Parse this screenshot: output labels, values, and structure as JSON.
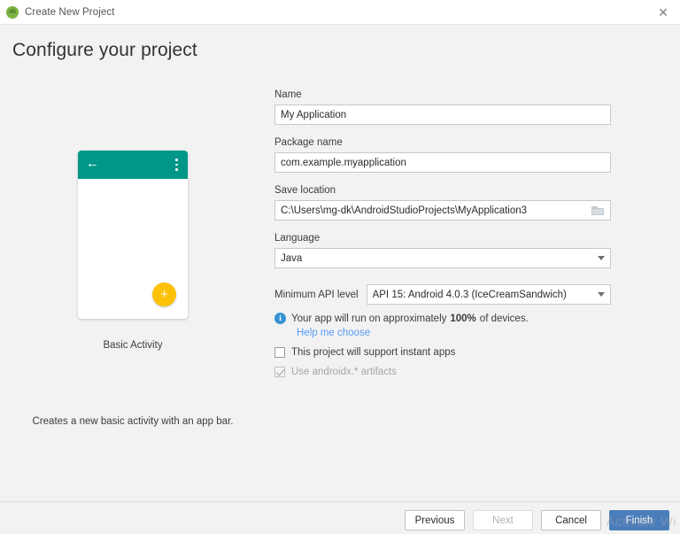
{
  "titlebar": {
    "title": "Create New Project",
    "icon": "android-icon",
    "close_label": "✕"
  },
  "heading": "Configure your project",
  "preview": {
    "activity_name": "Basic Activity",
    "description": "Creates a new basic activity with an app bar.",
    "appbar_color": "#009688",
    "fab_color": "#ffc107",
    "back_icon": "←",
    "fab_icon": "+"
  },
  "form": {
    "name": {
      "label": "Name",
      "value": "My Application"
    },
    "package": {
      "label": "Package name",
      "value": "com.example.myapplication"
    },
    "save_location": {
      "label": "Save location",
      "value": "C:\\Users\\mg-dk\\AndroidStudioProjects\\MyApplication3",
      "browse_icon": "folder-icon"
    },
    "language": {
      "label": "Language",
      "value": "Java"
    },
    "min_api": {
      "label": "Minimum API level",
      "value": "API 15: Android 4.0.3 (IceCreamSandwich)"
    },
    "device_info": {
      "prefix": "Your app will run on approximately",
      "percent": "100%",
      "suffix": "of devices.",
      "icon": "info-icon",
      "icon_color": "#3592d4"
    },
    "help_link": "Help me choose",
    "instant_apps": {
      "label": "This project will support instant apps",
      "checked": false
    },
    "androidx": {
      "label": "Use androidx.* artifacts",
      "checked": true,
      "disabled": true
    }
  },
  "footer": {
    "previous": "Previous",
    "next": "Next",
    "cancel": "Cancel",
    "finish": "Finish",
    "primary_color": "#4a7ebb"
  },
  "watermark": "Activate Wi"
}
